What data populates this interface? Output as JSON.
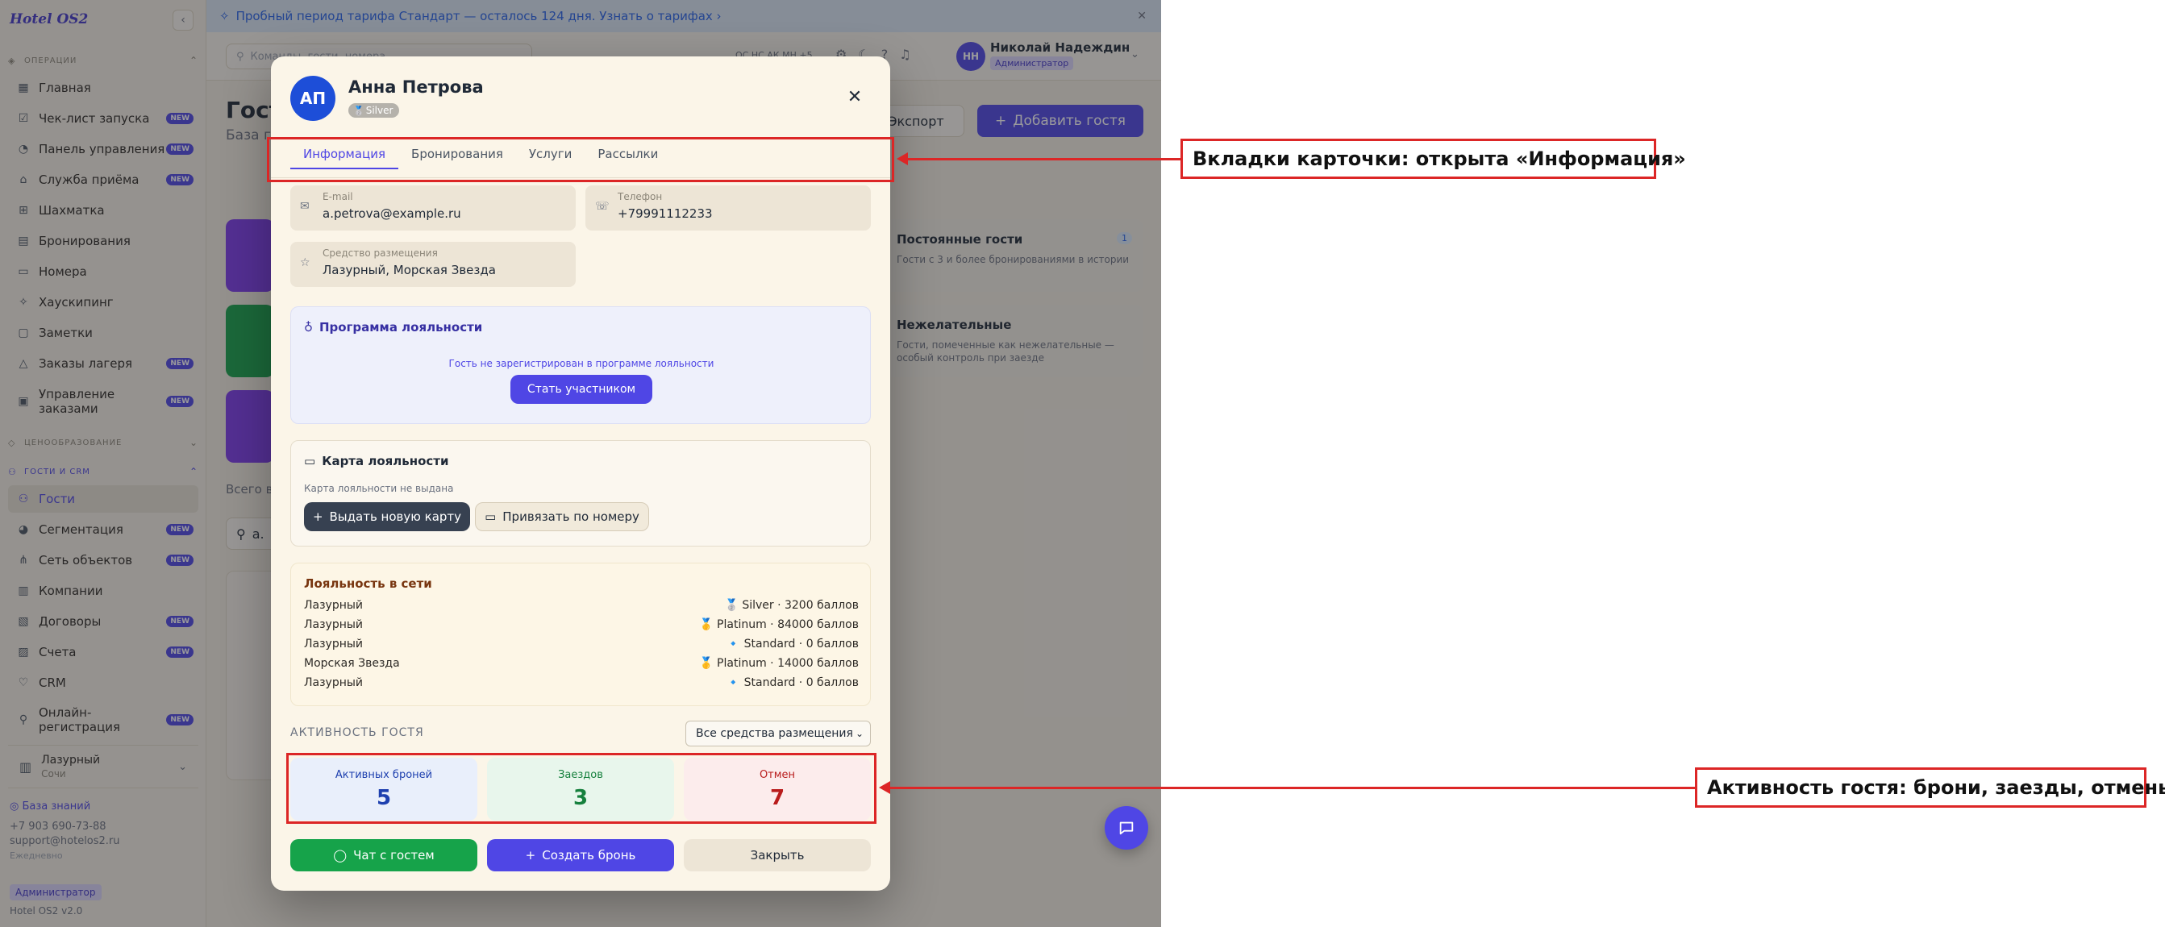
{
  "brand": "Hotel OS2",
  "sidebar": {
    "sections": {
      "operations": "ОПЕРАЦИИ",
      "pricing": "ЦЕНООБРАЗОВАНИЕ",
      "guests": "ГОСТИ И CRM"
    },
    "items": [
      {
        "label": "Главная",
        "icon": "grid-icon"
      },
      {
        "label": "Чек-лист запуска",
        "icon": "checklist-icon",
        "new": "NEW"
      },
      {
        "label": "Панель управления",
        "icon": "dashboard-icon",
        "new": "NEW"
      },
      {
        "label": "Служба приёма",
        "icon": "reception-icon",
        "new": "NEW"
      },
      {
        "label": "Шахматка",
        "icon": "table-icon"
      },
      {
        "label": "Бронирования",
        "icon": "calendar-icon"
      },
      {
        "label": "Номера",
        "icon": "bed-icon"
      },
      {
        "label": "Хаускипинг",
        "icon": "sparkle-icon"
      },
      {
        "label": "Заметки",
        "icon": "note-icon"
      },
      {
        "label": "Заказы лагеря",
        "icon": "tent-icon",
        "new": "NEW"
      },
      {
        "label": "Управление заказами",
        "icon": "orders-icon",
        "new": "NEW"
      },
      {
        "label": "Гости",
        "icon": "users-icon"
      },
      {
        "label": "Сегментация",
        "icon": "pie-icon",
        "new": "NEW"
      },
      {
        "label": "Сеть объектов",
        "icon": "network-icon",
        "new": "NEW"
      },
      {
        "label": "Компании",
        "icon": "building-icon"
      },
      {
        "label": "Договоры",
        "icon": "contract-icon",
        "new": "NEW"
      },
      {
        "label": "Счета",
        "icon": "invoice-icon",
        "new": "NEW"
      },
      {
        "label": "CRM",
        "icon": "heart-icon"
      },
      {
        "label": "Онлайн-регистрация",
        "icon": "person-add-icon",
        "new": "NEW"
      }
    ],
    "property": {
      "name": "Лазурный",
      "city": "Сочи"
    },
    "knowledge_base": "База знаний",
    "phone": "+7 903 690-73-88",
    "email": "support@hotelos2.ru",
    "schedule": "Ежедневно",
    "role": "Администратор",
    "version": "Hotel OS2 v2.0"
  },
  "trial_banner": "Пробный период тарифа Стандарт — осталось 124 дня. Узнать о тарифах ›",
  "topbar": {
    "search_placeholder": "Команды, гости, номера...",
    "hotkeys": "ОС НС АК МН +5",
    "user_initials": "НН",
    "user_name": "Николай Надеждин",
    "user_role": "Администратор"
  },
  "page": {
    "title": "Гости",
    "subtitle": "База г",
    "export_label": "Экспорт",
    "add_guest_label": "Добавить гостя",
    "total_label": "Всего в",
    "guest_search_value": "а.",
    "segments": [
      {
        "title": "Постоянные гости",
        "desc": "Гости с 3 и более бронированиями в истории",
        "count": "1"
      },
      {
        "title": "Нежелательные",
        "desc": "Гости, помеченные как нежелательные — особый контроль при заезде"
      }
    ]
  },
  "modal": {
    "initials": "АП",
    "name": "Анна Петрова",
    "tier_badge": "Silver",
    "tabs": [
      "Информация",
      "Бронирования",
      "Услуги",
      "Рассылки"
    ],
    "fields": {
      "email_label": "E-mail",
      "email_value": "a.petrova@example.ru",
      "phone_label": "Телефон",
      "phone_value": "+79991112233",
      "property_label": "Средство размещения",
      "property_value": "Лазурный, Морская Звезда"
    },
    "loyalty_program": {
      "title": "Программа лояльности",
      "message": "Гость не зарегистрирован в программе лояльности",
      "join_label": "Стать участником"
    },
    "loyalty_card": {
      "title": "Карта лояльности",
      "message": "Карта лояльности не выдана",
      "issue_label": "Выдать новую карту",
      "bind_label": "Привязать по номеру"
    },
    "network_loyalty": {
      "title": "Лояльность в сети",
      "rows": [
        {
          "property": "Лазурный",
          "level": "🥈 Silver · 3200 баллов"
        },
        {
          "property": "Лазурный",
          "level": "🥇 Platinum · 84000 баллов"
        },
        {
          "property": "Лазурный",
          "level": "🔹 Standard · 0 баллов"
        },
        {
          "property": "Морская Звезда",
          "level": "🥇 Platinum · 14000 баллов"
        },
        {
          "property": "Лазурный",
          "level": "🔹 Standard · 0 баллов"
        }
      ]
    },
    "activity": {
      "title": "АКТИВНОСТЬ ГОСТЯ",
      "filter": "Все средства размещения",
      "stats": [
        {
          "label": "Активных броней",
          "value": "5"
        },
        {
          "label": "Заездов",
          "value": "3"
        },
        {
          "label": "Отмен",
          "value": "7"
        }
      ]
    },
    "buttons": {
      "chat": "Чат с гостем",
      "create_booking": "Создать бронь",
      "close": "Закрыть"
    }
  },
  "annotations": {
    "tabs_callout": "Вкладки карточки: открыта «Информация»",
    "activity_callout": "Активность гостя: брони, заезды, отмены"
  },
  "colors": {
    "accent": "#4f46e5",
    "annotation": "#dc2626",
    "success": "#16a34a"
  }
}
